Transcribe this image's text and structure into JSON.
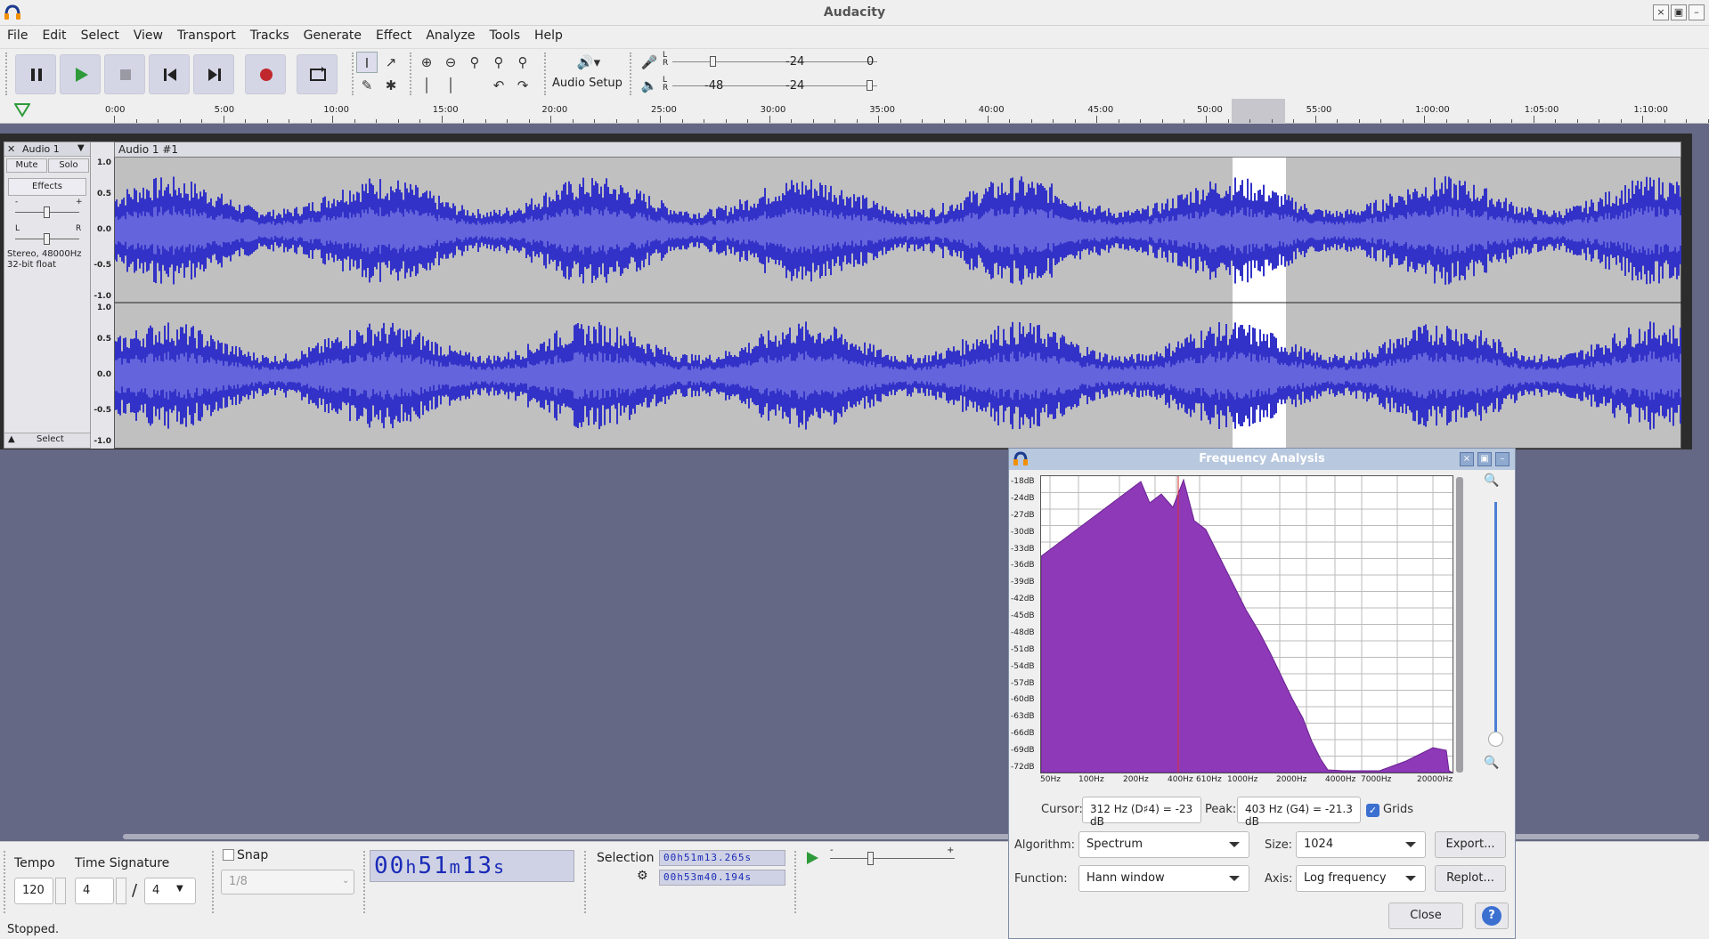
{
  "window": {
    "title": "Audacity"
  },
  "window_controls": {
    "close": "×",
    "restore": "▣",
    "minimize": "–"
  },
  "menu": [
    "File",
    "Edit",
    "Select",
    "View",
    "Transport",
    "Tracks",
    "Generate",
    "Effect",
    "Analyze",
    "Tools",
    "Help"
  ],
  "toolbar": {
    "audio_setup_label": "Audio Setup",
    "meter_record_ticks": [
      "-24",
      "0"
    ],
    "meter_play_ticks": [
      "-48",
      "-24"
    ],
    "meter_lr": [
      "L",
      "R"
    ]
  },
  "ruler": {
    "ticks": [
      "0:00",
      "5:00",
      "10:00",
      "15:00",
      "20:00",
      "25:00",
      "30:00",
      "35:00",
      "40:00",
      "45:00",
      "50:00",
      "55:00",
      "1:00:00",
      "1:05:00",
      "1:10:00"
    ]
  },
  "track": {
    "name": "Audio 1",
    "clip_title": "Audio 1 #1",
    "mute": "Mute",
    "solo": "Solo",
    "effects": "Effects",
    "gain_min": "-",
    "gain_max": "+",
    "pan_left": "L",
    "pan_right": "R",
    "info_line1": "Stereo, 48000Hz",
    "info_line2": "32-bit float",
    "select": "Select",
    "vruler": [
      "1.0",
      "0.5",
      "0.0",
      "-0.5",
      "-1.0"
    ]
  },
  "bottom": {
    "tempo_label": "Tempo",
    "tempo_value": "120",
    "time_sig_label": "Time Signature",
    "time_sig_num": "4",
    "time_sig_slash": "/",
    "time_sig_den": "4",
    "snap_label": "Snap",
    "snap_value": "1/8",
    "time_display": [
      "0",
      "0",
      "h",
      "5",
      "1",
      "m",
      "1",
      "3",
      "s"
    ],
    "selection_label": "Selection",
    "selection_start": "00h51m13.265s",
    "selection_end": "00h53m40.194s",
    "playspeed_min": "-",
    "playspeed_max": "+"
  },
  "status": "Stopped.",
  "freq": {
    "title": "Frequency Analysis",
    "db_labels": [
      "-18dB",
      "-24dB",
      "-27dB",
      "-30dB",
      "-33dB",
      "-36dB",
      "-39dB",
      "-42dB",
      "-45dB",
      "-48dB",
      "-51dB",
      "-54dB",
      "-57dB",
      "-60dB",
      "-63dB",
      "-66dB",
      "-69dB",
      "-72dB"
    ],
    "hz_labels": [
      "50Hz",
      "100Hz",
      "200Hz",
      "400Hz",
      "610Hz",
      "1000Hz",
      "2000Hz",
      "4000Hz",
      "7000Hz",
      "20000Hz"
    ],
    "cursor_label": "Cursor:",
    "cursor_value": "312 Hz (D♯4) = -23 dB",
    "peak_label": "Peak:",
    "peak_value": "403 Hz (G4) = -21.3 dB",
    "grids_label": "Grids",
    "grids_checked": true,
    "algorithm_label": "Algorithm:",
    "algorithm_value": "Spectrum",
    "size_label": "Size:",
    "size_value": "1024",
    "export_label": "Export...",
    "function_label": "Function:",
    "function_value": "Hann window",
    "axis_label": "Axis:",
    "axis_value": "Log frequency",
    "replot_label": "Replot...",
    "close_label": "Close",
    "help_label": "?"
  }
}
